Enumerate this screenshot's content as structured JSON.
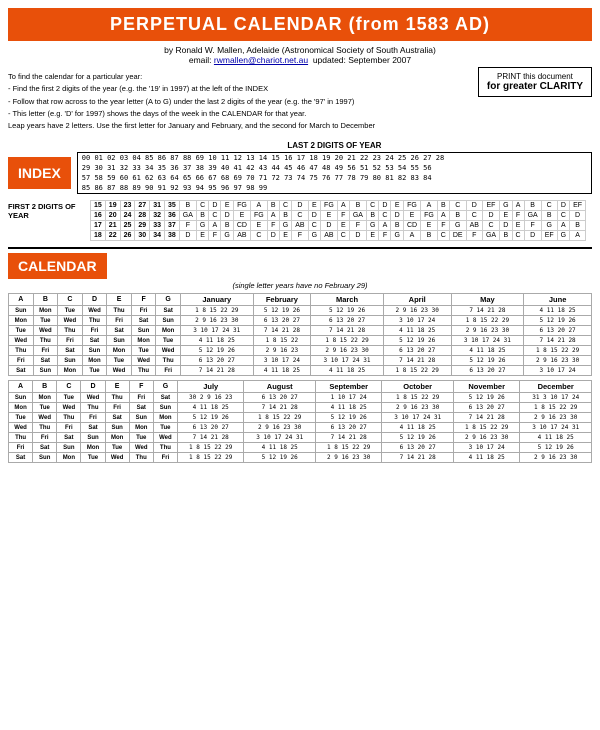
{
  "header": {
    "title": "PERPETUAL CALENDAR  (from 1583 AD)"
  },
  "subtitle": {
    "author": "by Ronald W. Mallen, Adelaide (Astronomical Society of South Australia)",
    "email_label": "email:",
    "email": "rwmallen@chariot.net.au",
    "updated": "updated: September 2007"
  },
  "instructions": {
    "line1": "To find the calendar for a particular year:",
    "line2": "- Find the first 2 digits of the year (e.g. the '19' in 1997) at the left of the INDEX",
    "line3": "- Follow that row across to the year letter (A to G) under the last 2 digits of the year (e.g. the '97' in 1997)",
    "line4": "- This letter (e.g. 'D' for 1997) shows the days of the week in the CALENDAR for that year.",
    "line5": "Leap years have 2 letters. Use the first letter for January and February, and the second for March to December"
  },
  "print_box": {
    "line1": "PRINT this document",
    "line2": "for greater CLARITY"
  },
  "index": {
    "label": "INDEX",
    "last2_title": "LAST 2 DIGITS OF YEAR",
    "rows": [
      "00 01 02 03 04  85 86 87 88  69 10 11 12  13 14 15 16  17 18 19 20  21 22 23 24  25 26 27 28",
      "29 30 31 32 33  34 35 36 37  38 39 40 41  42 43 44 45  46 47 48 49  56 51 52 53  54 55 56",
      "57 58 59 60 61  62 63 64 65  66 67 68 69  70 71 72 73  74 75 76 77  78 79 80 81  82 83 84",
      "85 86 87 88 89  90 91 92 93  94 95 96 97  98 99"
    ],
    "first2_label": "FIRST 2 DIGITS OF YEAR",
    "first2_rows": [
      {
        "nums": [
          "15",
          "19",
          "23",
          "27",
          "31",
          "35"
        ],
        "letters": [
          "B",
          "C",
          "D",
          "E",
          "FG",
          "A",
          "B",
          "C",
          "D",
          "E",
          "FG",
          "A",
          "B",
          "C",
          "D",
          "E",
          "FG",
          "A",
          "B",
          "C",
          "D",
          "EF",
          "G",
          "A",
          "B",
          "C",
          "D",
          "EF"
        ]
      },
      {
        "nums": [
          "16",
          "20",
          "24",
          "28",
          "32",
          "36"
        ],
        "letters": [
          "GA",
          "B",
          "C",
          "D",
          "E",
          "FG",
          "A",
          "B",
          "C",
          "D",
          "E",
          "F",
          "GA",
          "B",
          "C",
          "D",
          "E",
          "FG",
          "A",
          "B",
          "C",
          "D",
          "E",
          "F",
          "GA",
          "B",
          "C",
          "D"
        ]
      },
      {
        "nums": [
          "17",
          "21",
          "25",
          "29",
          "33",
          "37"
        ],
        "letters": [
          "F",
          "G",
          "A",
          "B",
          "CD",
          "E",
          "F",
          "G",
          "AB",
          "C",
          "D",
          "E",
          "F",
          "G",
          "A",
          "B",
          "CD",
          "E",
          "F",
          "G",
          "AB",
          "C",
          "D",
          "E",
          "F",
          "G",
          "A",
          "B"
        ]
      },
      {
        "nums": [
          "18",
          "22",
          "26",
          "30",
          "34",
          "38"
        ],
        "letters": [
          "D",
          "E",
          "F",
          "G",
          "AB",
          "C",
          "D",
          "E",
          "F",
          "G",
          "AB",
          "C",
          "D",
          "E",
          "F",
          "G",
          "A",
          "B",
          "C",
          "DE",
          "F",
          "GA",
          "B",
          "C",
          "D",
          "EF",
          "G",
          "A"
        ]
      }
    ]
  },
  "calendar": {
    "label": "CALENDAR",
    "note": "(single letter years have no February 29)",
    "top_months": [
      "A",
      "B",
      "C",
      "D",
      "E",
      "F",
      "G",
      "January",
      "February",
      "March",
      "April",
      "May",
      "June"
    ],
    "bottom_months": [
      "A",
      "B",
      "C",
      "D",
      "E",
      "F",
      "G",
      "July",
      "August",
      "September",
      "October",
      "November",
      "December"
    ],
    "letter_cols": [
      "A",
      "B",
      "C",
      "D",
      "E",
      "F",
      "G"
    ],
    "days_header": [
      "Sun",
      "Mon",
      "Tue",
      "Wed",
      "Thu",
      "Fri",
      "Sat"
    ],
    "top_data": {
      "headers": [
        "A",
        "B",
        "C",
        "D",
        "E",
        "F",
        "G",
        "January",
        "February",
        "March",
        "April",
        "May",
        "June"
      ],
      "day_rows": [
        [
          "Sun",
          "Mon",
          "Tue",
          "Wed",
          "Thu",
          "Fri",
          "Sat",
          "1  8 15 22 29",
          "5 12 19 26",
          "5 12 19 26",
          "2  9 16 23 30",
          "7 14 21 28",
          "4 11 18 25"
        ],
        [
          "Mon",
          "Tue",
          "Wed",
          "Thu",
          "Fri",
          "Sat",
          "Sun",
          "2  9 16 23 30",
          "6 13 20 27",
          "6 13 20 27",
          "3 10 17 24",
          "1  8 15 22 29",
          "5 12 19 26"
        ],
        [
          "Tue",
          "Wed",
          "Thu",
          "Fri",
          "Sat",
          "Sun",
          "Mon",
          "3 10 17 24 31",
          "7 14 21 28",
          "7 14 21 28",
          "4 11 18 25",
          "2  9 16 23 30",
          "6 13 20 27"
        ],
        [
          "Wed",
          "Thu",
          "Fri",
          "Sat",
          "Sun",
          "Mon",
          "Tue",
          "4 11 18 25",
          "1  8 15 22",
          "1  8 15 22 29",
          "5 12 19 26",
          "3 10 17 24 31",
          "7 14 21 28"
        ],
        [
          "Thu",
          "Fri",
          "Sat",
          "Sun",
          "Mon",
          "Tue",
          "Wed",
          "5 12 19 26",
          "2  9 16 23",
          "2  9 16 23 30",
          "6 13 20 27",
          "4 11 18 25",
          "1  8 15 22 29"
        ],
        [
          "Fri",
          "Sat",
          "Sun",
          "Mon",
          "Tue",
          "Wed",
          "Thu",
          "6 13 20 27",
          "3 10 17 24",
          "3 10 17 24 31",
          "7 14 21 28",
          "5 12 19 26",
          "2  9 16 23 30"
        ],
        [
          "Sat",
          "Sun",
          "Mon",
          "Tue",
          "Wed",
          "Thu",
          "Fri",
          "7 14 21 28",
          "4 11 18 25",
          "4 11 18 25",
          "1  8 15 22 29",
          "6 13 20 27",
          "3 10 17 24"
        ]
      ]
    },
    "bottom_data": {
      "headers": [
        "A",
        "B",
        "C",
        "D",
        "E",
        "F",
        "G",
        "July",
        "August",
        "September",
        "October",
        "November",
        "December"
      ],
      "day_rows": [
        [
          "Sun",
          "Mon",
          "Tue",
          "Wed",
          "Thu",
          "Fri",
          "Sat",
          "30  2  9 16 23",
          "6 13 20 27",
          "1 10 17 24",
          "1  8 15 22 29",
          "5 12 19 26",
          "31  3 10 17 24"
        ],
        [
          "Mon",
          "Tue",
          "Wed",
          "Thu",
          "Fri",
          "Sat",
          "Sun",
          "4 11 18 25",
          "7 14 21 28",
          "4 11 18 25",
          "2  9 16 23 30",
          "6 13 20 27",
          "1  8 15 22 29"
        ],
        [
          "Tue",
          "Wed",
          "Thu",
          "Fri",
          "Sat",
          "Sun",
          "Mon",
          "5 12 19 26",
          "1  8 15 22 29",
          "5 12 19 26",
          "3 10 17 24 31",
          "7 14 21 28",
          "2  9 16 23 30"
        ],
        [
          "Wed",
          "Thu",
          "Fri",
          "Sat",
          "Sun",
          "Mon",
          "Tue",
          "6 13 20 27",
          "2  9 16 23 30",
          "6 13 20 27",
          "4 11 18 25",
          "1  8 15 22 29",
          "3 10 17 24 31"
        ],
        [
          "Thu",
          "Fri",
          "Sat",
          "Sun",
          "Mon",
          "Tue",
          "Wed",
          "7 14 21 28",
          "3 10 17 24 31",
          "7 14 21 28",
          "5 12 19 26",
          "2  9 16 23 30",
          "4 11 18 25"
        ],
        [
          "Fri",
          "Sat",
          "Sun",
          "Mon",
          "Tue",
          "Wed",
          "Thu",
          "1  8 15 22 29",
          "4 11 18 25",
          "1  8 15 22 29",
          "6 13 20 27",
          "3 10 17 24",
          "5 12 19 26"
        ],
        [
          "Sat",
          "Sun",
          "Mon",
          "Tue",
          "Wed",
          "Thu",
          "Fri",
          "1  8 15 22 29",
          "5 12 19 26",
          "2  9 16 23 30",
          "7 14 21 28",
          "4 11 18 25",
          "2  9 16 23 30"
        ]
      ]
    }
  }
}
